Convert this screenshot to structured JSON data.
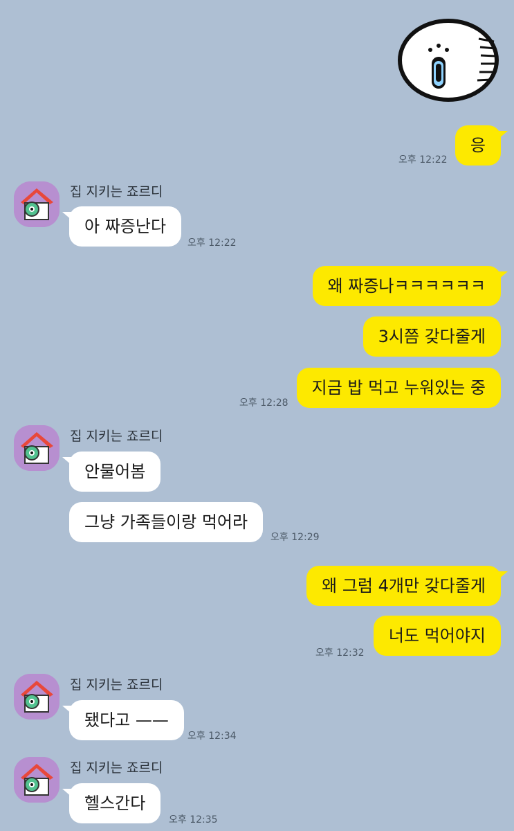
{
  "contact": {
    "name": "집 지키는 죠르디"
  },
  "sticker": {
    "icon": "screaming-face-sticker-icon"
  },
  "messages": [
    {
      "text": "응",
      "time": "오후 12:22"
    },
    {
      "text": "아 짜증난다",
      "time": "오후 12:22"
    },
    {
      "text": "왜 짜증나ㅋㅋㅋㅋㅋㅋ"
    },
    {
      "text": "3시쯤 갖다줄게"
    },
    {
      "text": "지금 밥 먹고 누워있는 중",
      "time": "오후 12:28"
    },
    {
      "text": "안물어봄"
    },
    {
      "text": "그냥 가족들이랑 먹어라",
      "time": "오후 12:29"
    },
    {
      "text": "왜 그럼 4개만 갖다줄게"
    },
    {
      "text": "너도 먹어야지",
      "time": "오후 12:32"
    },
    {
      "text": "됐다고 ——",
      "time": "오후 12:34"
    },
    {
      "text": "헬스간다",
      "time": "오후 12:35"
    }
  ],
  "colors": {
    "background": "#aebfd3",
    "my_bubble": "#fde900",
    "their_bubble": "#ffffff"
  }
}
